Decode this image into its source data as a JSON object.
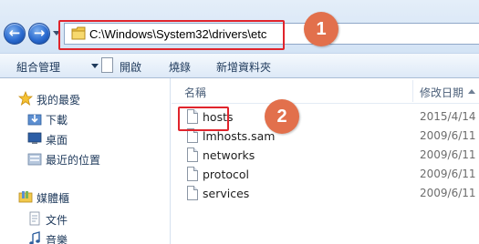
{
  "address_bar": {
    "path": "C:\\Windows\\System32\\drivers\\etc"
  },
  "callouts": [
    "1",
    "2"
  ],
  "toolbar": {
    "organize": "組合管理",
    "open": "開啟",
    "burn": "燒錄",
    "new_folder": "新增資料夾"
  },
  "sidebar": {
    "favorites": "我的最愛",
    "items_fav": [
      "下載",
      "桌面",
      "最近的位置"
    ],
    "libraries": "媒體櫃",
    "items_lib": [
      "文件",
      "音樂"
    ]
  },
  "file_list": {
    "col_name": "名稱",
    "col_date": "修改日期",
    "files": [
      {
        "name": "hosts",
        "date": "2015/4/14"
      },
      {
        "name": "lmhosts.sam",
        "date": "2009/6/11"
      },
      {
        "name": "networks",
        "date": "2009/6/11"
      },
      {
        "name": "protocol",
        "date": "2009/6/11"
      },
      {
        "name": "services",
        "date": "2009/6/11"
      }
    ]
  },
  "colors": {
    "highlight": "#e0242c",
    "callout": "#e2704c"
  }
}
